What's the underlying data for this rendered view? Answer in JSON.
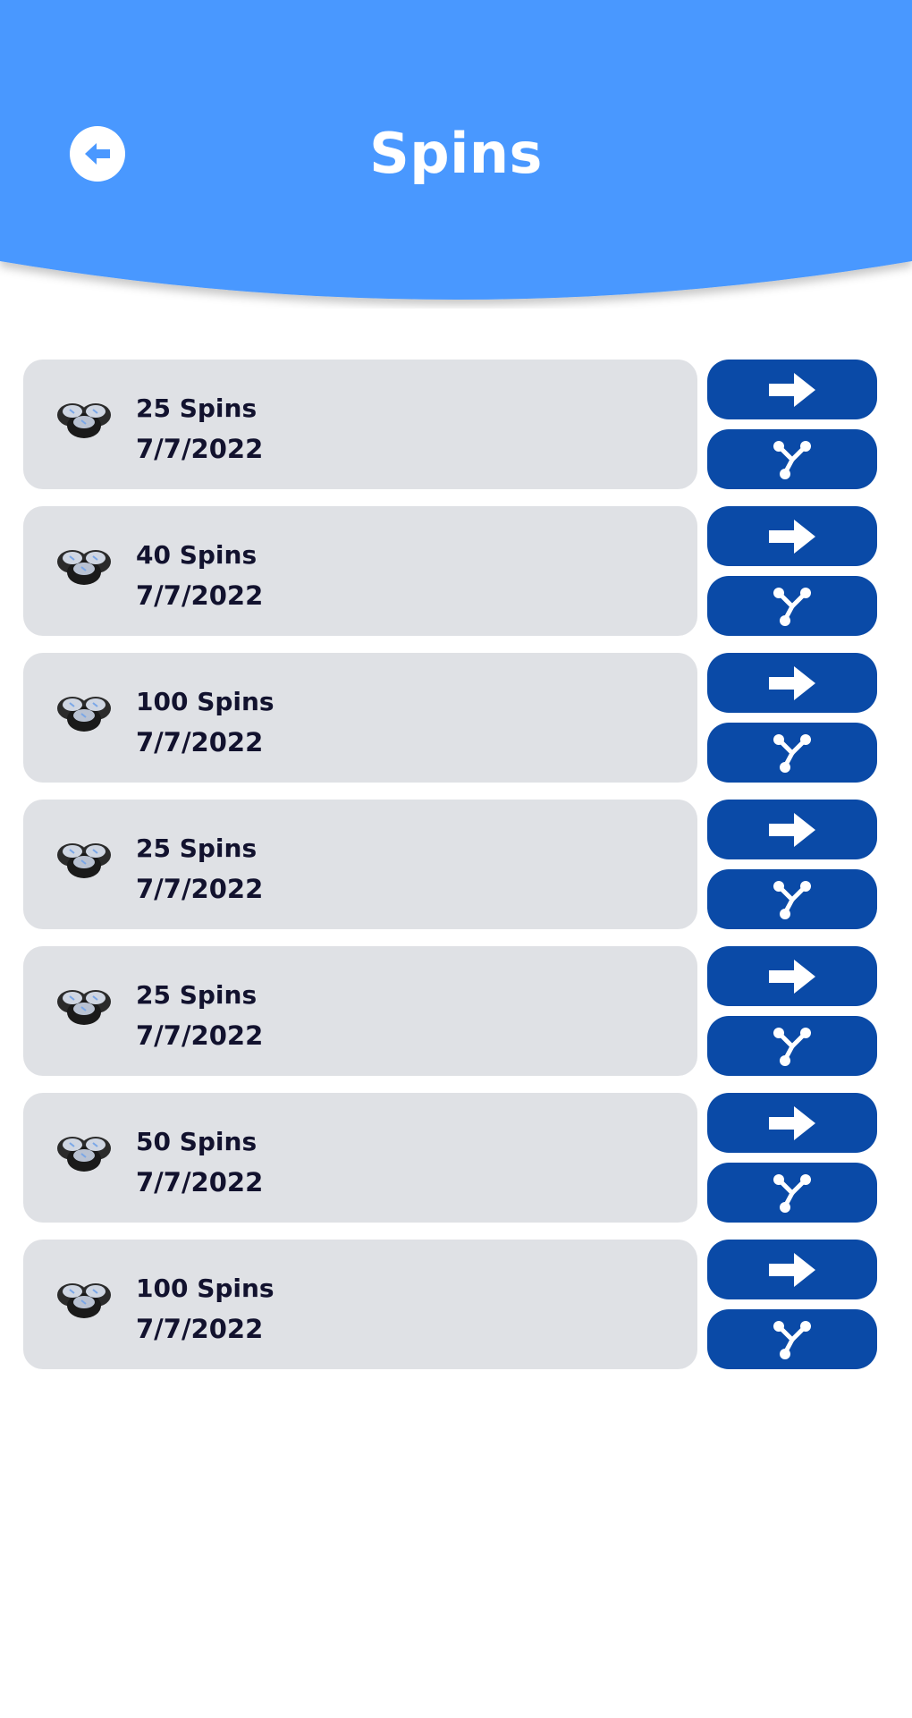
{
  "header": {
    "title": "Spins",
    "back_icon": "arrow-left-circle-icon",
    "background_color": "#4a98ff"
  },
  "colors": {
    "card_background": "#dfe1e5",
    "action_button": "#0a4aa7",
    "text_dark": "#12122e"
  },
  "rows": [
    {
      "spins": "25 Spins",
      "date": "7/7/2022",
      "icon": "coin-stack-icon",
      "open_icon": "arrow-right-icon",
      "share_icon": "share-icon"
    },
    {
      "spins": "40 Spins",
      "date": "7/7/2022",
      "icon": "coin-stack-icon",
      "open_icon": "arrow-right-icon",
      "share_icon": "share-icon"
    },
    {
      "spins": "100 Spins",
      "date": "7/7/2022",
      "icon": "coin-stack-icon",
      "open_icon": "arrow-right-icon",
      "share_icon": "share-icon"
    },
    {
      "spins": "25 Spins",
      "date": "7/7/2022",
      "icon": "coin-stack-icon",
      "open_icon": "arrow-right-icon",
      "share_icon": "share-icon"
    },
    {
      "spins": "25 Spins",
      "date": "7/7/2022",
      "icon": "coin-stack-icon",
      "open_icon": "arrow-right-icon",
      "share_icon": "share-icon"
    },
    {
      "spins": "50 Spins",
      "date": "7/7/2022",
      "icon": "coin-stack-icon",
      "open_icon": "arrow-right-icon",
      "share_icon": "share-icon"
    },
    {
      "spins": "100 Spins",
      "date": "7/7/2022",
      "icon": "coin-stack-icon",
      "open_icon": "arrow-right-icon",
      "share_icon": "share-icon"
    }
  ]
}
